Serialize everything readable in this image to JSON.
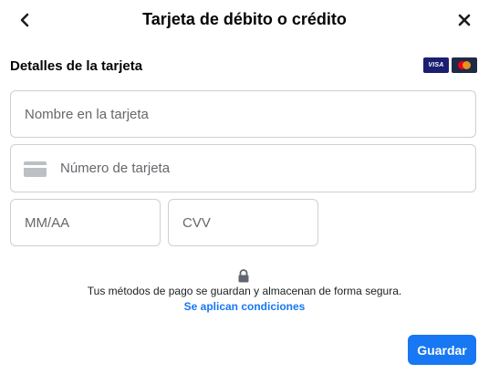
{
  "header": {
    "title": "Tarjeta de débito o crédito",
    "back_icon": "chevron-left-icon",
    "close_icon": "close-icon"
  },
  "card_details": {
    "section_title": "Detalles de la tarjeta",
    "brand_logos": [
      {
        "name": "visa-logo",
        "text": "VISA"
      },
      {
        "name": "mastercard-logo"
      }
    ]
  },
  "form": {
    "name_placeholder": "Nombre en la tarjeta",
    "name_value": "",
    "number_placeholder": "Número de tarjeta",
    "number_value": "",
    "number_icon": "credit-card-icon",
    "expiry_placeholder": "MM/AA",
    "expiry_value": "",
    "cvv_placeholder": "CVV",
    "cvv_value": ""
  },
  "security": {
    "icon": "lock-icon",
    "message": "Tus métodos de pago se guardan y almacenan de forma segura.",
    "terms_link": "Se aplican condiciones"
  },
  "actions": {
    "save_label": "Guardar"
  },
  "colors": {
    "accent": "#1877f2",
    "border": "#ccd0d5",
    "placeholder": "#65676b",
    "text": "#1c1e21"
  }
}
